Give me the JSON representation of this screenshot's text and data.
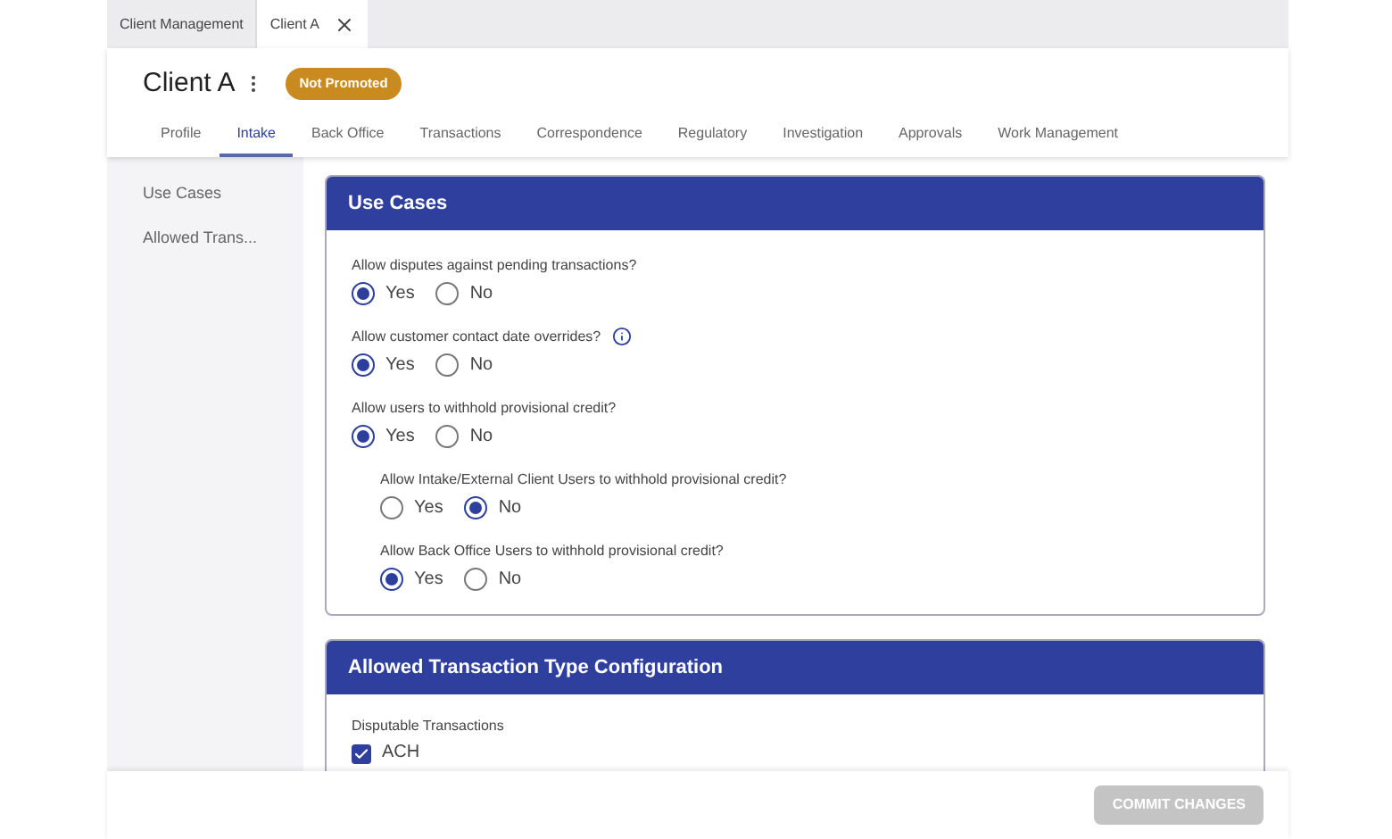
{
  "doc_tabs": [
    {
      "label": "Client Management",
      "selected": false,
      "closable": false
    },
    {
      "label": "Client A",
      "selected": true,
      "closable": true
    }
  ],
  "header": {
    "title": "Client A",
    "badge": "Not Promoted"
  },
  "nav_tabs": [
    {
      "label": "Profile",
      "selected": false
    },
    {
      "label": "Intake",
      "selected": true
    },
    {
      "label": "Back Office",
      "selected": false
    },
    {
      "label": "Transactions",
      "selected": false
    },
    {
      "label": "Correspondence",
      "selected": false
    },
    {
      "label": "Regulatory",
      "selected": false
    },
    {
      "label": "Investigation",
      "selected": false
    },
    {
      "label": "Approvals",
      "selected": false
    },
    {
      "label": "Work Management",
      "selected": false
    }
  ],
  "sidebar": {
    "items": [
      "Use Cases",
      "Allowed Trans..."
    ]
  },
  "use_cases": {
    "title": "Use Cases",
    "questions": [
      {
        "label": "Allow disputes against pending transactions?",
        "info": false,
        "options": [
          {
            "label": "Yes",
            "selected": true
          },
          {
            "label": "No",
            "selected": false
          }
        ]
      },
      {
        "label": "Allow customer contact date overrides?",
        "info": true,
        "options": [
          {
            "label": "Yes",
            "selected": true
          },
          {
            "label": "No",
            "selected": false
          }
        ]
      },
      {
        "label": "Allow users to withhold provisional credit?",
        "info": false,
        "options": [
          {
            "label": "Yes",
            "selected": true
          },
          {
            "label": "No",
            "selected": false
          }
        ],
        "children": [
          {
            "label": "Allow Intake/External Client Users to withhold provisional credit?",
            "info": false,
            "options": [
              {
                "label": "Yes",
                "selected": false
              },
              {
                "label": "No",
                "selected": true
              }
            ]
          },
          {
            "label": "Allow Back Office Users to withhold provisional credit?",
            "info": false,
            "options": [
              {
                "label": "Yes",
                "selected": true
              },
              {
                "label": "No",
                "selected": false
              }
            ]
          }
        ]
      }
    ]
  },
  "transaction_config": {
    "title": "Allowed Transaction Type Configuration",
    "section": "Disputable Transactions",
    "items": [
      {
        "label": "ACH",
        "checked": true
      }
    ]
  },
  "footer": {
    "button": "COMMIT CHANGES",
    "disabled": true
  }
}
